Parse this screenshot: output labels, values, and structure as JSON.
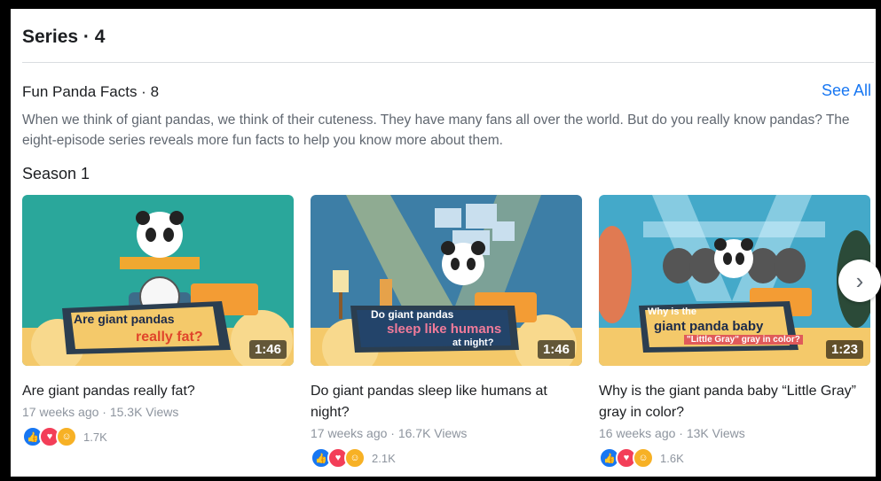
{
  "series": {
    "title": "Series · 4"
  },
  "playlist": {
    "title": "Fun Panda Facts · 8",
    "see_all": "See All",
    "description": "When we think of giant pandas, we think of their cuteness. They have many fans all over the world. But do you really know pandas? The eight-episode series reveals more fun facts to help you know more about them.",
    "season_label": "Season 1"
  },
  "videos": [
    {
      "title": "Are giant pandas really fat?",
      "meta": "17 weeks ago · 15.3K Views",
      "duration": "1:46",
      "reaction_count": "1.7K",
      "thumb_text_1": "Are giant pandas",
      "thumb_text_2": "really fat?"
    },
    {
      "title": "Do giant pandas sleep like humans at night?",
      "meta": "17 weeks ago · 16.7K Views",
      "duration": "1:46",
      "reaction_count": "2.1K",
      "thumb_text_1": "Do giant pandas",
      "thumb_text_2": "sleep like humans",
      "thumb_text_3": "at night?"
    },
    {
      "title": "Why is the giant panda baby “Little Gray” gray in color?",
      "meta": "16 weeks ago · 13K Views",
      "duration": "1:23",
      "reaction_count": "1.6K",
      "thumb_text_1": "Why is the",
      "thumb_text_2": "giant panda baby",
      "thumb_text_3": "\"Little Gray\" gray in color?"
    }
  ],
  "colors": {
    "accent": "#1877f2",
    "teal": "#2aa79b",
    "steel": "#3d7ea6",
    "blue_stage": "#44a9c9"
  },
  "icons": {
    "next": "chevron-right-icon",
    "like": "like-icon",
    "love": "love-icon",
    "care": "care-icon"
  }
}
